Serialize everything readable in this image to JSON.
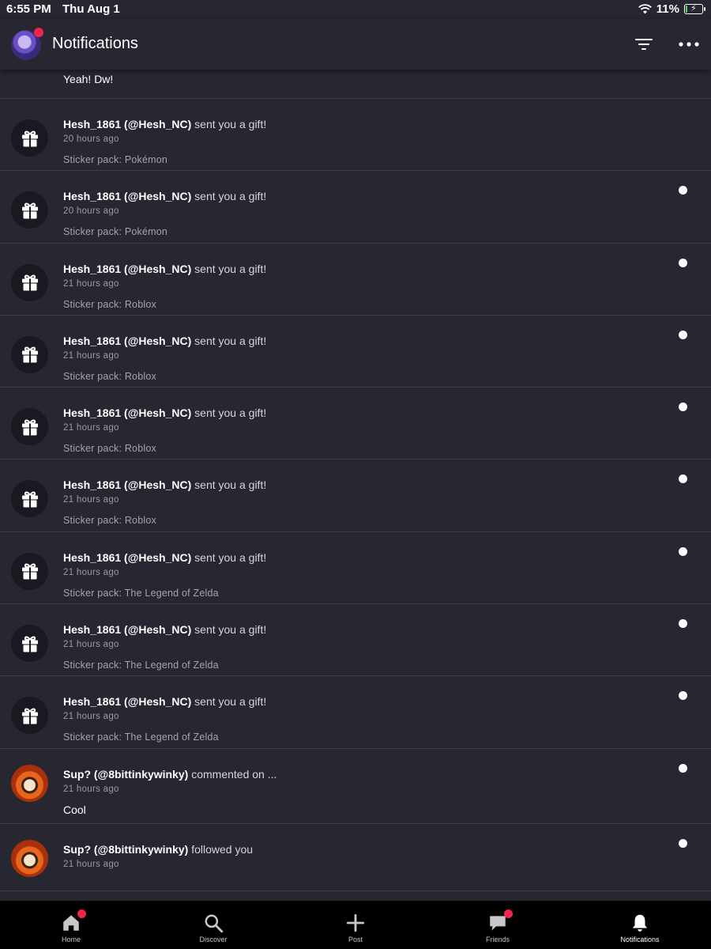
{
  "status_bar": {
    "time": "6:55 PM",
    "date": "Thu Aug 1",
    "battery": "11%",
    "battery_level": 0.11
  },
  "header": {
    "title": "Notifications",
    "filter_icon": "filter-icon",
    "more_icon": "more-icon"
  },
  "partial_row": {
    "preview": "Yeah! Dw!"
  },
  "notifications": [
    {
      "type": "gift",
      "name": "Hesh_1861 (@Hesh_NC)",
      "action": "sent you a gift!",
      "time": "20 hours ago",
      "detail": "Sticker pack: Pokémon",
      "unread": false
    },
    {
      "type": "gift",
      "name": "Hesh_1861 (@Hesh_NC)",
      "action": "sent you a gift!",
      "time": "20 hours ago",
      "detail": "Sticker pack: Pokémon",
      "unread": true
    },
    {
      "type": "gift",
      "name": "Hesh_1861 (@Hesh_NC)",
      "action": "sent you a gift!",
      "time": "21 hours ago",
      "detail": "Sticker pack: Roblox",
      "unread": true
    },
    {
      "type": "gift",
      "name": "Hesh_1861 (@Hesh_NC)",
      "action": "sent you a gift!",
      "time": "21 hours ago",
      "detail": "Sticker pack: Roblox",
      "unread": true
    },
    {
      "type": "gift",
      "name": "Hesh_1861 (@Hesh_NC)",
      "action": "sent you a gift!",
      "time": "21 hours ago",
      "detail": "Sticker pack: Roblox",
      "unread": true
    },
    {
      "type": "gift",
      "name": "Hesh_1861 (@Hesh_NC)",
      "action": "sent you a gift!",
      "time": "21 hours ago",
      "detail": "Sticker pack: Roblox",
      "unread": true
    },
    {
      "type": "gift",
      "name": "Hesh_1861 (@Hesh_NC)",
      "action": "sent you a gift!",
      "time": "21 hours ago",
      "detail": "Sticker pack: The Legend of Zelda",
      "unread": true
    },
    {
      "type": "gift",
      "name": "Hesh_1861 (@Hesh_NC)",
      "action": "sent you a gift!",
      "time": "21 hours ago",
      "detail": "Sticker pack: The Legend of Zelda",
      "unread": true
    },
    {
      "type": "gift",
      "name": "Hesh_1861 (@Hesh_NC)",
      "action": "sent you a gift!",
      "time": "21 hours ago",
      "detail": "Sticker pack: The Legend of Zelda",
      "unread": true
    },
    {
      "type": "comment",
      "name": "Sup? (@8bittinkywinky)",
      "action": "commented on ...",
      "time": "21 hours ago",
      "comment": "Cool",
      "unread": true
    },
    {
      "type": "follow",
      "name": "Sup? (@8bittinkywinky)",
      "action": "followed you",
      "time": "21 hours ago",
      "unread": true
    }
  ],
  "tabs": [
    {
      "label": "Home",
      "icon": "home-icon",
      "badge": true,
      "active": false
    },
    {
      "label": "Discover",
      "icon": "search-icon",
      "badge": false,
      "active": false
    },
    {
      "label": "Post",
      "icon": "plus-icon",
      "badge": false,
      "active": false
    },
    {
      "label": "Friends",
      "icon": "chat-icon",
      "badge": true,
      "active": false
    },
    {
      "label": "Notifications",
      "icon": "bell-icon",
      "badge": false,
      "active": true
    }
  ],
  "colors": {
    "background": "#262731",
    "divider": "#3c3d48",
    "badge": "#f0244f",
    "tabbar": "#000000"
  }
}
